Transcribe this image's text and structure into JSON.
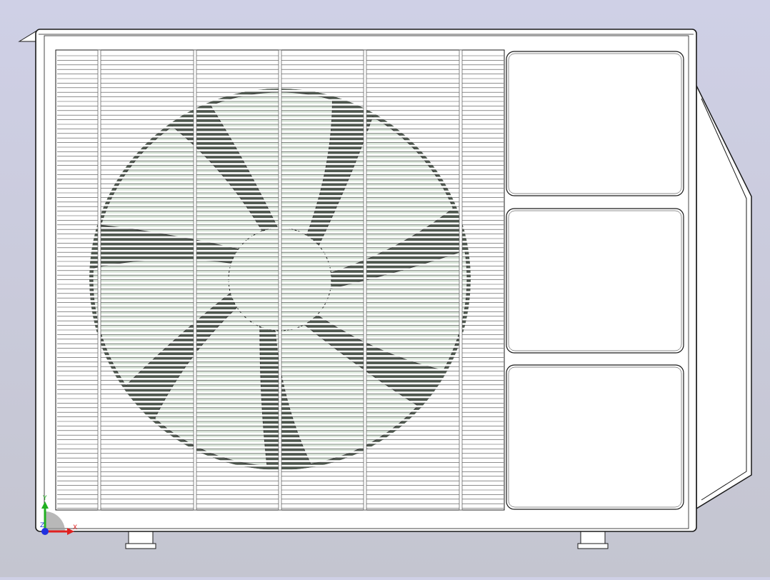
{
  "viewport": {
    "background_top": "#cfd0e6",
    "background_bottom": "#c4c5d0"
  },
  "model": {
    "name": "outdoor-ac-unit",
    "panel_count": 3,
    "fan_blade_count": 7,
    "feet_count": 2,
    "colors": {
      "body": "#ffffff",
      "edge": "#1a1a1a",
      "fan_blade": "#dde8dd",
      "fan_shadow": "#505a50"
    }
  },
  "triad": {
    "x_label": "X",
    "y_label": "Y",
    "z_label": "Z",
    "x_color": "#e02020",
    "y_color": "#20b020",
    "z_color": "#2030e0"
  }
}
